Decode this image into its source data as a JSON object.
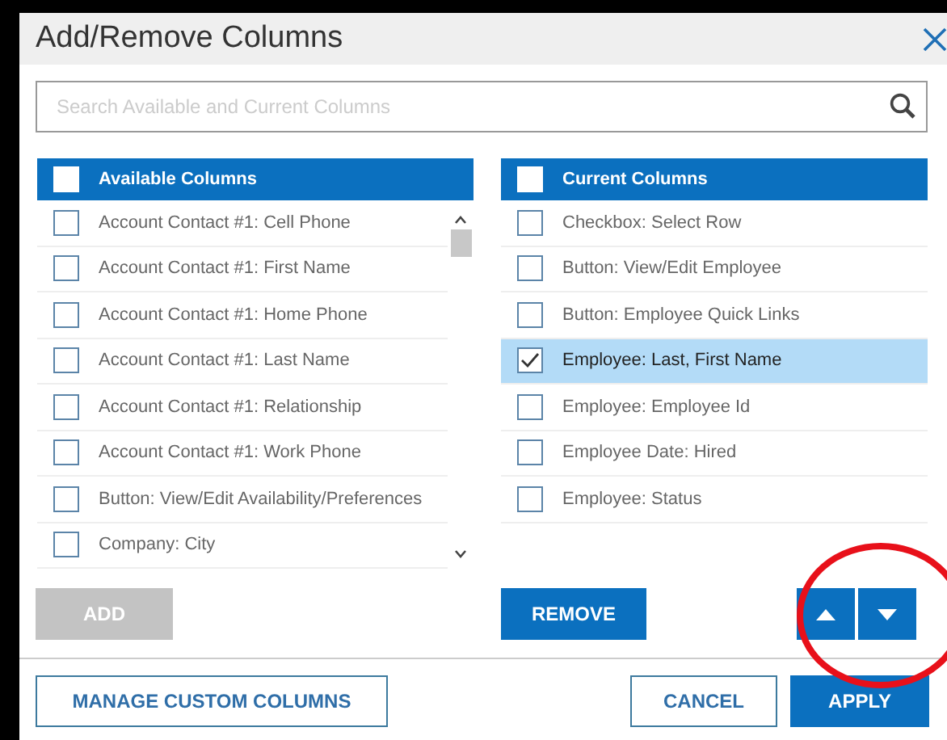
{
  "dialog": {
    "title": "Add/Remove Columns"
  },
  "search": {
    "placeholder": "Search Available and Current Columns"
  },
  "available": {
    "header": "Available Columns",
    "header_checked": false,
    "items": [
      {
        "label": "Account Contact #1: Cell Phone",
        "checked": false,
        "selected": false
      },
      {
        "label": "Account Contact #1: First Name",
        "checked": false,
        "selected": false
      },
      {
        "label": "Account Contact #1: Home Phone",
        "checked": false,
        "selected": false
      },
      {
        "label": "Account Contact #1: Last Name",
        "checked": false,
        "selected": false
      },
      {
        "label": "Account Contact #1: Relationship",
        "checked": false,
        "selected": false
      },
      {
        "label": "Account Contact #1: Work Phone",
        "checked": false,
        "selected": false
      },
      {
        "label": "Button: View/Edit Availability/Preferences",
        "checked": false,
        "selected": false
      },
      {
        "label": "Company: City",
        "checked": false,
        "selected": false
      }
    ]
  },
  "current": {
    "header": "Current Columns",
    "header_checked": false,
    "items": [
      {
        "label": "Checkbox: Select Row",
        "checked": false,
        "selected": false
      },
      {
        "label": "Button: View/Edit Employee",
        "checked": false,
        "selected": false
      },
      {
        "label": "Button: Employee Quick Links",
        "checked": false,
        "selected": false
      },
      {
        "label": "Employee: Last, First Name",
        "checked": true,
        "selected": true
      },
      {
        "label": "Employee: Employee Id",
        "checked": false,
        "selected": false
      },
      {
        "label": "Employee Date: Hired",
        "checked": false,
        "selected": false
      },
      {
        "label": "Employee: Status",
        "checked": false,
        "selected": false
      }
    ]
  },
  "add_button": {
    "label": "ADD",
    "disabled": true
  },
  "remove_button": {
    "label": "REMOVE",
    "disabled": false
  },
  "footer": {
    "manage_button": "MANAGE CUSTOM COLUMNS",
    "cancel_button": "CANCEL",
    "apply_button": "APPLY"
  }
}
